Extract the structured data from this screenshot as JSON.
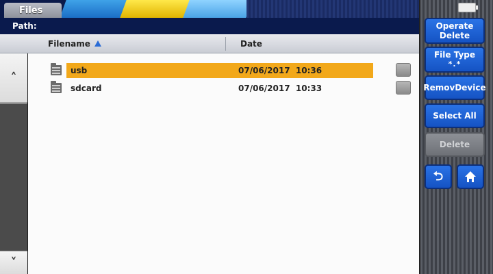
{
  "header": {
    "tab_label": "Files",
    "path_label": "Path:"
  },
  "columns": {
    "filename": "Filename",
    "date": "Date",
    "sort": "ascending"
  },
  "files": [
    {
      "name": "usb",
      "date": "07/06/2017",
      "time": "10:36",
      "selected": true
    },
    {
      "name": "sdcard",
      "date": "07/06/2017",
      "time": "10:33",
      "selected": false
    }
  ],
  "sidebar": {
    "operate_line1": "Operate",
    "operate_line2": "Delete",
    "file_type_label": "File Type",
    "file_type_value": "*.*",
    "remove_device": "RemovDevice",
    "select_all": "Select All",
    "delete": "Delete"
  },
  "icons": {
    "back": "back-arrow-icon",
    "home": "home-icon",
    "battery": "battery-icon",
    "scroll_up": "chevron-up-icon",
    "scroll_down": "chevron-down-icon",
    "file": "folder-icon"
  },
  "colors": {
    "selection": "#f2a81a",
    "button_blue": "#1e63d6",
    "header_navy": "#0a1a4d"
  }
}
